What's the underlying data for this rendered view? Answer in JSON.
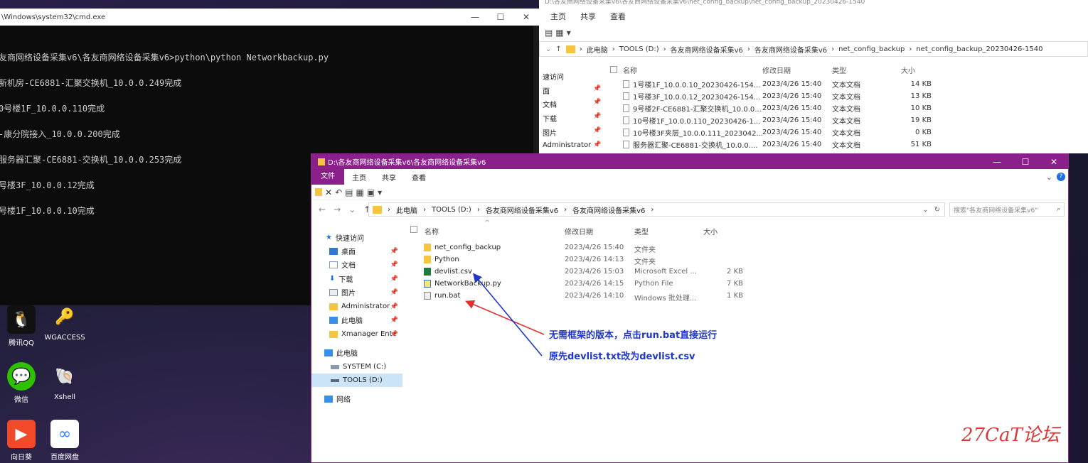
{
  "cmd": {
    "title": "\\Windows\\system32\\cmd.exe",
    "lines": [
      "友商网络设备采集v6\\各友商网络设备采集v6>python\\python Networkbackup.py",
      "新机房-CE6881-汇聚交换机_10.0.0.249完成",
      "0号楼1F_10.0.0.110完成",
      "-康分院接入_10.0.0.200完成",
      "服务器汇聚-CE6881-交换机_10.0.0.253完成",
      "号楼3F_10.0.0.12完成",
      "号楼1F_10.0.0.10完成"
    ]
  },
  "back_explorer": {
    "title": "D:\\各友商网络设备采集v6\\各友商网络设备采集v6\\net_config_backup\\net_config_backup_20230426-1540",
    "tabs": [
      "主页",
      "共享",
      "查看"
    ],
    "breadcrumb": [
      "此电脑",
      "TOOLS (D:)",
      "各友商网络设备采集v6",
      "各友商网络设备采集v6",
      "net_config_backup",
      "net_config_backup_20230426-1540"
    ],
    "columns": [
      "名称",
      "修改日期",
      "类型",
      "大小"
    ],
    "nav": [
      "速访问",
      "面",
      "文档",
      "下载",
      "图片",
      "Administrator"
    ],
    "files": [
      {
        "name": "1号楼1F_10.0.0.10_20230426-154...",
        "date": "2023/4/26 15:40",
        "type": "文本文档",
        "size": "14 KB"
      },
      {
        "name": "1号楼3F_10.0.0.12_20230426-154...",
        "date": "2023/4/26 15:40",
        "type": "文本文档",
        "size": "13 KB"
      },
      {
        "name": "9号楼2F-CE6881-汇聚交换机_10.0.0....",
        "date": "2023/4/26 15:40",
        "type": "文本文档",
        "size": "10 KB"
      },
      {
        "name": "10号楼1F_10.0.0.110_20230426-1...",
        "date": "2023/4/26 15:40",
        "type": "文本文档",
        "size": "19 KB"
      },
      {
        "name": "10号楼3F夹层_10.0.0.111_2023042...",
        "date": "2023/4/26 15:40",
        "type": "文本文档",
        "size": "0 KB"
      },
      {
        "name": "服务器汇聚-CE6881-交换机_10.0.0....",
        "date": "2023/4/26 15:40",
        "type": "文本文档",
        "size": "51 KB"
      }
    ]
  },
  "desktop": {
    "icons": [
      {
        "label": "腾讯QQ",
        "icon": "qq-icon"
      },
      {
        "label": "WGACCESS",
        "icon": "key-icon"
      },
      {
        "label": "微信",
        "icon": "wechat-icon"
      },
      {
        "label": "Xshell",
        "icon": "xshell-icon"
      },
      {
        "label": "向日葵",
        "icon": "sunflower-icon"
      },
      {
        "label": "百度网盘",
        "icon": "baidu-netdisk-icon"
      }
    ]
  },
  "front_explorer": {
    "title": "D:\\各友商网络设备采集v6\\各友商网络设备采集v6",
    "tabs": {
      "file": "文件",
      "home": "主页",
      "share": "共享",
      "view": "查看"
    },
    "breadcrumb": [
      "此电脑",
      "TOOLS (D:)",
      "各友商网络设备采集v6",
      "各友商网络设备采集v6"
    ],
    "search_placeholder": "搜索\"各友商网络设备采集v6\"",
    "columns": {
      "name": "名称",
      "date": "修改日期",
      "type": "类型",
      "size": "大小"
    },
    "sidebar": [
      {
        "label": "快速访问",
        "icon": "star-icon"
      },
      {
        "label": "桌面",
        "icon": "desktop-icon"
      },
      {
        "label": "文档",
        "icon": "document-icon"
      },
      {
        "label": "下载",
        "icon": "download-icon"
      },
      {
        "label": "图片",
        "icon": "pictures-icon"
      },
      {
        "label": "Administrator",
        "icon": "folder-icon"
      },
      {
        "label": "此电脑",
        "icon": "pc-icon"
      },
      {
        "label": "Xmanager Ente",
        "icon": "folder-icon"
      },
      {
        "label": "此电脑",
        "icon": "pc-icon"
      },
      {
        "label": "SYSTEM (C:)",
        "icon": "drive-icon"
      },
      {
        "label": "TOOLS (D:)",
        "icon": "drive-icon"
      },
      {
        "label": "网络",
        "icon": "network-icon"
      }
    ],
    "files": [
      {
        "name": "net_config_backup",
        "date": "2023/4/26 15:40",
        "type": "文件夹",
        "size": "",
        "icon": "folder-icon"
      },
      {
        "name": "Python",
        "date": "2023/4/26 14:13",
        "type": "文件夹",
        "size": "",
        "icon": "folder-icon"
      },
      {
        "name": "devlist.csv",
        "date": "2023/4/26 15:03",
        "type": "Microsoft Excel ...",
        "size": "2 KB",
        "icon": "excel-icon"
      },
      {
        "name": "NetworkBackup.py",
        "date": "2023/4/26 14:15",
        "type": "Python File",
        "size": "7 KB",
        "icon": "python-icon"
      },
      {
        "name": "run.bat",
        "date": "2023/4/26 14:10",
        "type": "Windows 批处理...",
        "size": "1 KB",
        "icon": "bat-icon"
      }
    ],
    "annotations": [
      "无需框架的版本，点击run.bat直接运行",
      "原先devlist.txt改为devlist.csv"
    ]
  },
  "watermark": "27CaT论坛",
  "colors": {
    "accent": "#8b1f8b",
    "note": "#1f36c9",
    "watermark": "#d83a3a"
  }
}
